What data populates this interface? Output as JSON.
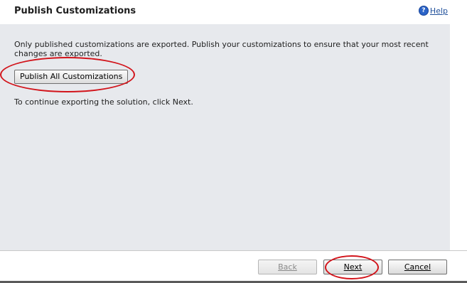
{
  "header": {
    "title": "Publish Customizations",
    "help_label": "Help",
    "help_icon": "help-question-icon"
  },
  "main": {
    "description": "Only published customizations are exported. Publish your customizations to ensure that your most recent changes are exported.",
    "publish_button_label": "Publish All Customizations",
    "continue_text": "To continue exporting the solution, click Next."
  },
  "footer": {
    "back_label": "Back",
    "next_label": "Next",
    "cancel_label": "Cancel"
  },
  "colors": {
    "panel_background": "#e7e9ed",
    "annotation_red": "#d2141b",
    "help_blue": "#2b64c8"
  }
}
